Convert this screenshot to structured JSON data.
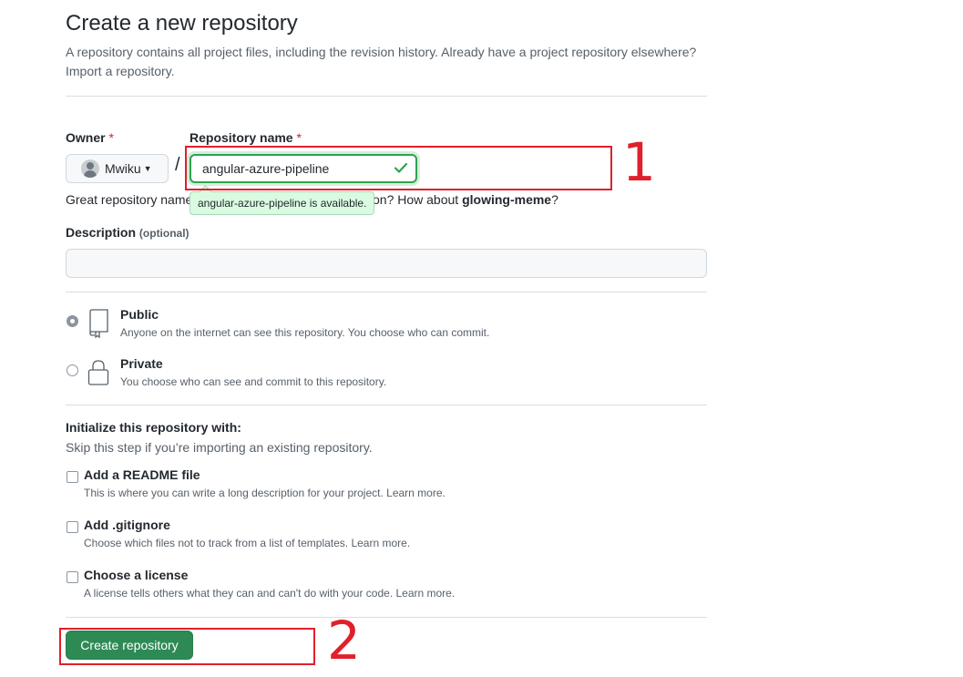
{
  "page": {
    "title": "Create a new repository",
    "subtitle": "A repository contains all project files, including the revision history. Already have a project repository elsewhere? Import a repository."
  },
  "owner": {
    "label": "Owner",
    "required_mark": "*",
    "selected": "Mwiku",
    "caret_icon": "triangle-down-icon"
  },
  "repo_name": {
    "label": "Repository name",
    "required_mark": "*",
    "separator": "/",
    "value": "angular-azure-pipeline",
    "status_icon": "check-icon",
    "availability_tooltip": "angular-azure-pipeline is available."
  },
  "suggestion": {
    "prefix": "Great repository name",
    "middle": "ed inspiration? How about",
    "name": "glowing-meme",
    "suffix": "?"
  },
  "description": {
    "label": "Description",
    "optional": "(optional)",
    "value": ""
  },
  "visibility": {
    "options": [
      {
        "title": "Public",
        "note": "Anyone on the internet can see this repository. You choose who can commit.",
        "icon": "repo-icon",
        "selected": true
      },
      {
        "title": "Private",
        "note": "You choose who can see and commit to this repository.",
        "icon": "lock-icon",
        "selected": false
      }
    ]
  },
  "initialize": {
    "title": "Initialize this repository with:",
    "subtitle": "Skip this step if you’re importing an existing repository.",
    "options": [
      {
        "title": "Add a README file",
        "note": "This is where you can write a long description for your project. Learn more.",
        "checked": false
      },
      {
        "title": "Add .gitignore",
        "note": "Choose which files not to track from a list of templates. Learn more.",
        "checked": false
      },
      {
        "title": "Choose a license",
        "note": "A license tells others what they can and can't do with your code. Learn more.",
        "checked": false
      }
    ]
  },
  "actions": {
    "create_label": "Create repository"
  },
  "annotations": {
    "step1": "1",
    "step2": "2",
    "highlight_color": "#e0202a"
  },
  "colors": {
    "primary_button": "#2e8a55",
    "success_border": "#2da44e",
    "tooltip_bg": "#dafbe1"
  }
}
